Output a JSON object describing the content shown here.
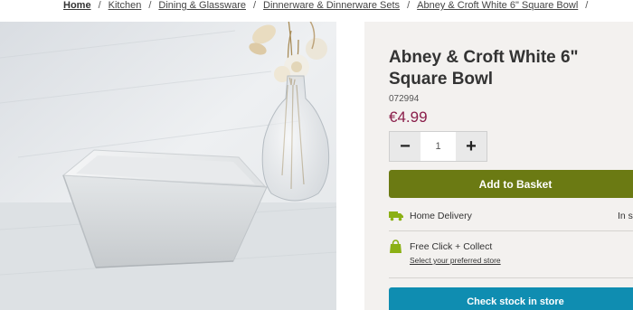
{
  "breadcrumb": {
    "items": [
      "Home",
      "Kitchen",
      "Dining & Glassware",
      "Dinnerware & Dinnerware Sets",
      "Abney & Croft White 6\" Square Bowl"
    ],
    "separator": "/"
  },
  "gallery": {
    "image_alt": "White square porcelain bowl beside a glass vase with dried flowers"
  },
  "product": {
    "title": "Abney & Croft White 6\" Square Bowl",
    "sku": "072994",
    "price": "€4.99",
    "quantity": "1",
    "decrement_symbol": "−",
    "increment_symbol": "+",
    "add_to_basket_label": "Add to Basket"
  },
  "fulfilment": {
    "delivery_label": "Home Delivery",
    "delivery_status": "In s",
    "click_collect_label": "Free Click + Collect",
    "store_link_label": "Select your preferred store",
    "check_stock_label": "Check stock in store"
  },
  "colors": {
    "price": "#8a1e4a",
    "add_button": "#6b7a13",
    "check_stock_button": "#0f8db1",
    "icon_green": "#8bb014",
    "panel_bg": "#f3f1ef"
  },
  "icons": {
    "delivery": "truck-icon",
    "click_collect": "shopping-bag-icon"
  }
}
